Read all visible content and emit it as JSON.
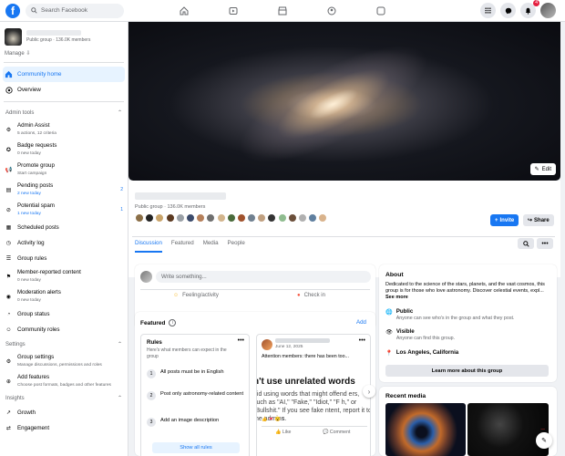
{
  "header": {
    "logo": "f",
    "search_placeholder": "Search Facebook",
    "nav_icons": [
      "home-icon",
      "video-icon",
      "marketplace-icon",
      "groups-icon",
      "gaming-icon"
    ],
    "notification_count": "4"
  },
  "sidebar": {
    "group_meta": "Public group · 136.0K members",
    "manage_label": "Manage",
    "primary": [
      {
        "label": "Community home"
      },
      {
        "label": "Overview"
      }
    ],
    "admin_tools_title": "Admin tools",
    "admin_tools": [
      {
        "label": "Admin Assist",
        "sub": "5 actions, 12 criteria"
      },
      {
        "label": "Badge requests",
        "sub": "0 new today"
      },
      {
        "label": "Promote group",
        "sub": "Start campaign"
      },
      {
        "label": "Pending posts",
        "sub": "2 new today",
        "count": "2"
      },
      {
        "label": "Potential spam",
        "sub": "1 new today",
        "count": "1"
      },
      {
        "label": "Scheduled posts"
      },
      {
        "label": "Activity log"
      },
      {
        "label": "Group rules"
      },
      {
        "label": "Member-reported content",
        "sub": "0 new today"
      },
      {
        "label": "Moderation alerts",
        "sub": "0 new today"
      },
      {
        "label": "Group status"
      },
      {
        "label": "Community roles"
      }
    ],
    "settings_title": "Settings",
    "settings": [
      {
        "label": "Group settings",
        "sub": "Manage discussions, permissions and roles"
      },
      {
        "label": "Add features",
        "sub": "Choose post formats, badges and other features"
      }
    ],
    "insights_title": "Insights",
    "insights": [
      {
        "label": "Growth"
      },
      {
        "label": "Engagement"
      }
    ]
  },
  "cover": {
    "edit_label": "Edit"
  },
  "group": {
    "meta": "Public group · 136.0K members",
    "invite_label": "Invite",
    "share_label": "Share",
    "tabs": [
      "Discussion",
      "Featured",
      "Media",
      "People"
    ]
  },
  "composer": {
    "placeholder": "Write something...",
    "feeling_label": "Feeling/activity",
    "checkin_label": "Check in"
  },
  "featured": {
    "title": "Featured",
    "add_label": "Add",
    "rules_title": "Rules",
    "rules_desc": "Here's what members can expect in the group",
    "rules": [
      {
        "num": "1",
        "text": "All posts must be in English"
      },
      {
        "num": "2",
        "text": "Post only astronomy-related content"
      },
      {
        "num": "3",
        "text": "Add an image description"
      }
    ],
    "show_all_label": "Show all rules",
    "post": {
      "date": "June 12, 2025",
      "text": "Attention members: there has been too...",
      "big_title": "n't use unrelated words",
      "body": "oid using words that might offend ers, such as \"AI,\" \"Fake,\" \"Idiot,\" \"F h,\" or \"Bullshit.\" If you see fake ntent, report it to the admins.",
      "reactions": "6",
      "like_label": "Like",
      "comment_label": "Comment"
    }
  },
  "about": {
    "title": "About",
    "desc": "Dedicated to the science of the stars, planets, and the vast cosmos, this group is for those who love astronomy. Discover celestial events, expl...",
    "see_more": "See more",
    "public_title": "Public",
    "public_desc": "Anyone can see who's in the group and what they post.",
    "visible_title": "Visible",
    "visible_desc": "Anyone can find this group.",
    "location": "Los Angeles, California",
    "learn_more_label": "Learn more about this group"
  },
  "media": {
    "title": "Recent media"
  },
  "colors": {
    "accent": "#1877f2",
    "background": "#f0f2f5",
    "active_bg": "#e7f3ff"
  }
}
